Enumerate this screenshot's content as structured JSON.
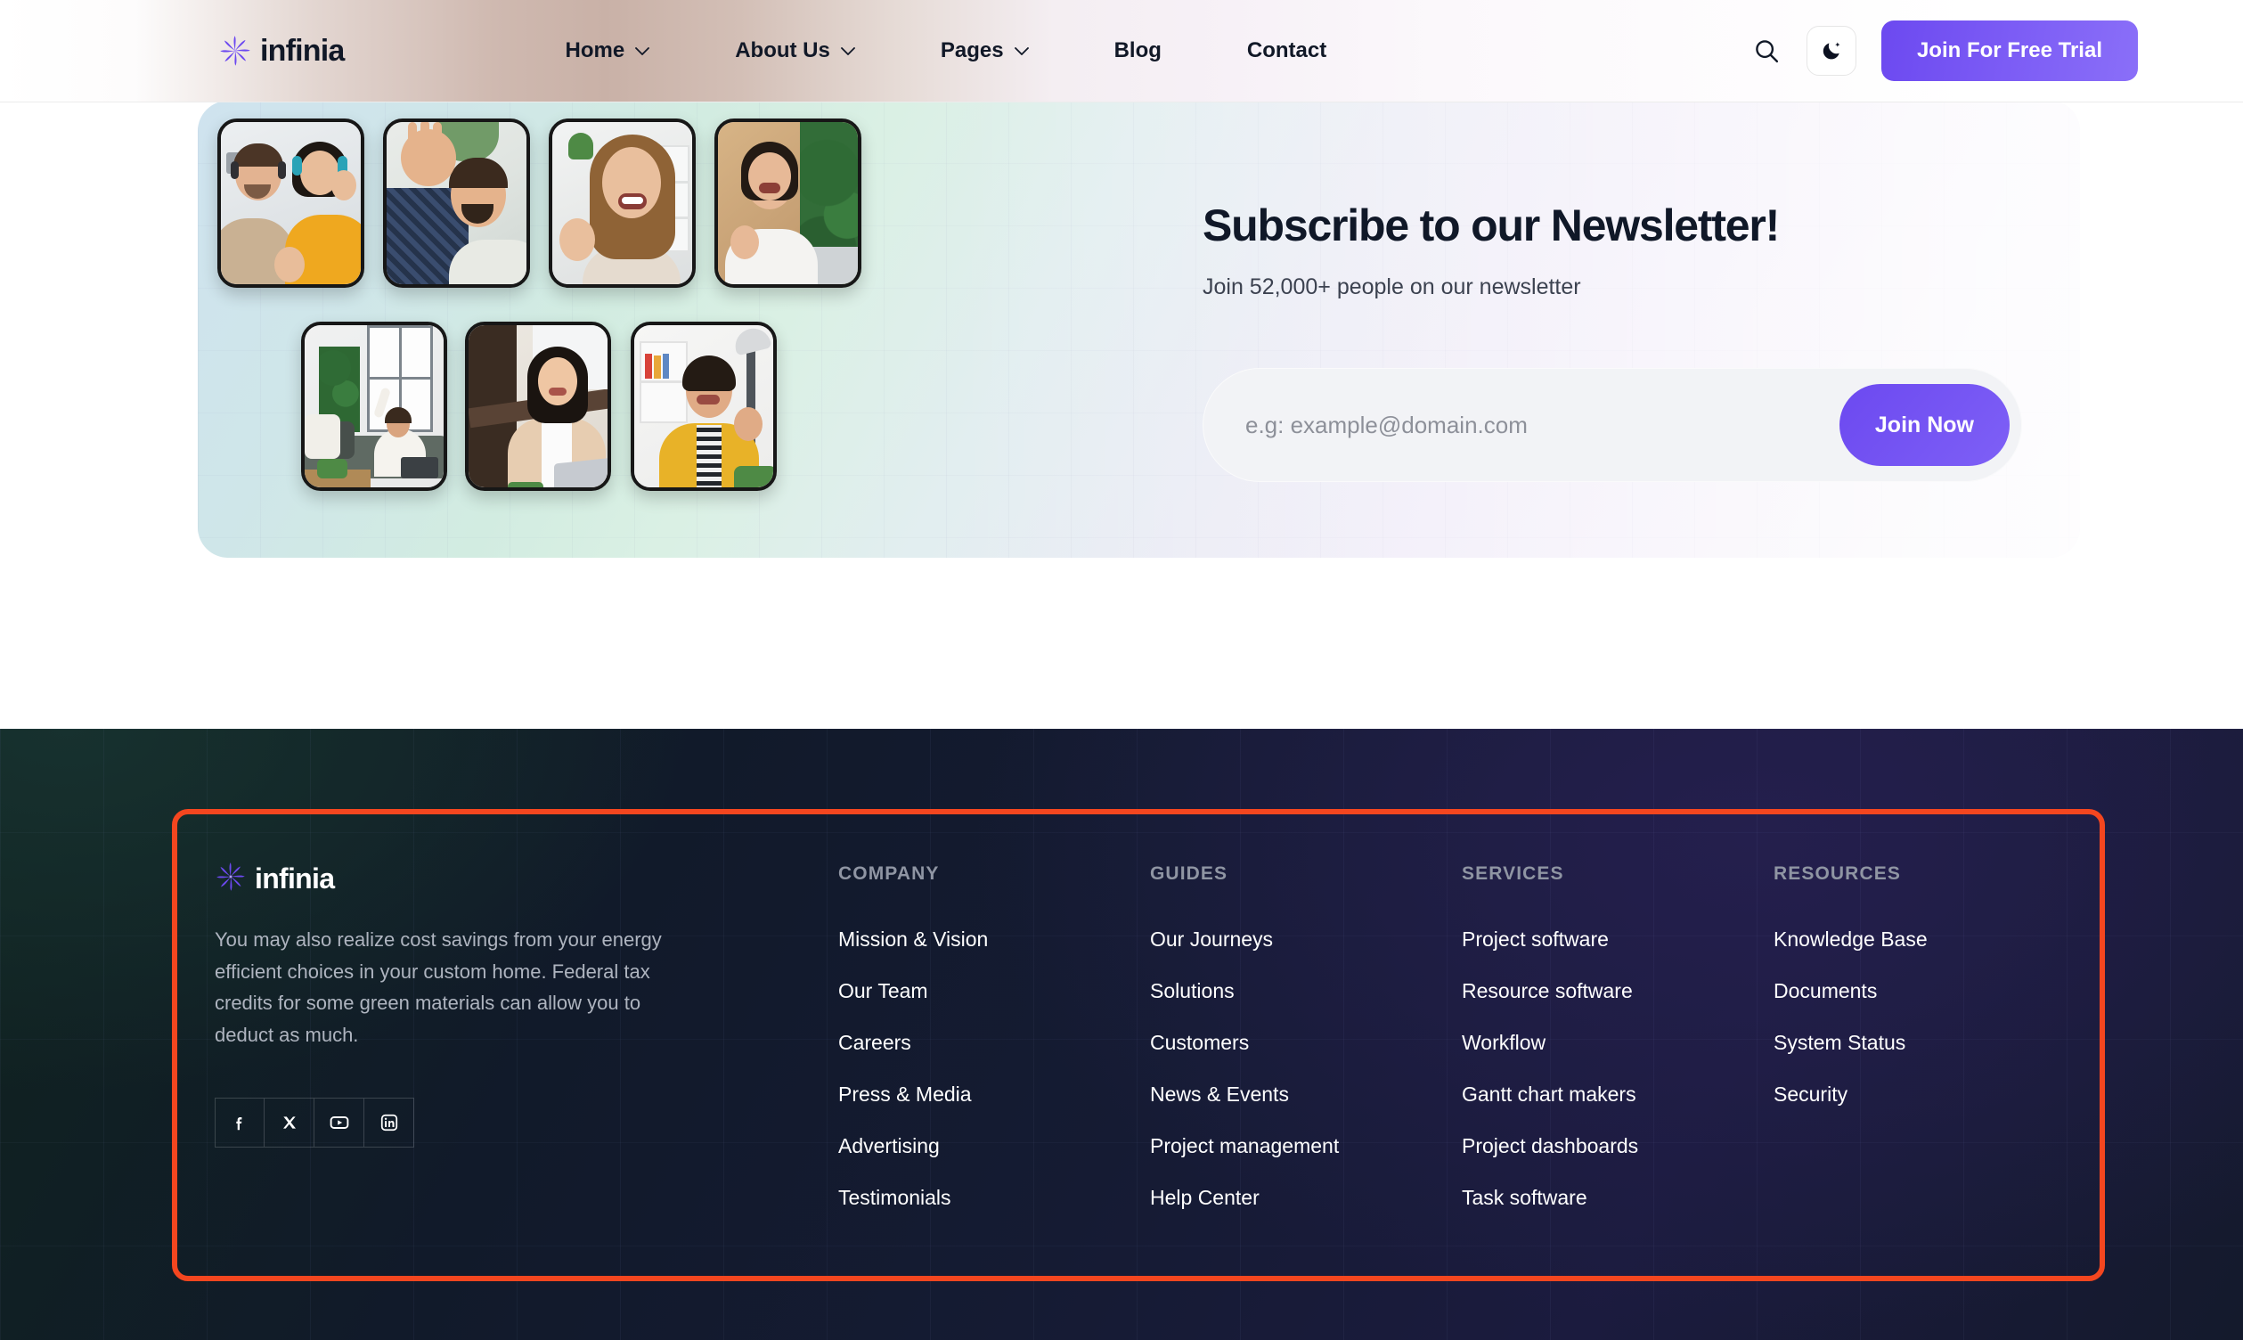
{
  "brand": {
    "name": "infinia",
    "logo_icon": "pinwheel-flower-icon",
    "accent": "#7c5cf5"
  },
  "header": {
    "nav": [
      {
        "label": "Home",
        "has_dropdown": true
      },
      {
        "label": "About Us",
        "has_dropdown": true
      },
      {
        "label": "Pages",
        "has_dropdown": true
      },
      {
        "label": "Blog",
        "has_dropdown": false
      },
      {
        "label": "Contact",
        "has_dropdown": false
      }
    ],
    "search_icon": "search-icon",
    "theme_icon": "moon-dark-mode-icon",
    "cta_label": "Join For Free Trial"
  },
  "newsletter": {
    "title": "Subscribe to our Newsletter!",
    "subtitle": "Join 52,000+ people on our newsletter",
    "email_placeholder": "e.g: example@domain.com",
    "email_value": "",
    "submit_label": "Join Now",
    "photos": [
      {
        "alt": "Smiling couple with headphones waving"
      },
      {
        "alt": "Bearded man lying down waving hand"
      },
      {
        "alt": "Woman with long hair laughing and waving"
      },
      {
        "alt": "Woman in white shirt smiling by plant"
      },
      {
        "alt": "Woman celebrating on couch with laptop"
      },
      {
        "alt": "Woman in beige shirt smiling at laptop"
      },
      {
        "alt": "Man in yellow jacket waving at desk"
      }
    ]
  },
  "footer": {
    "description": "You may also realize cost savings from your energy efficient choices in your custom home. Federal tax credits for some green materials can allow you to deduct as much.",
    "socials": [
      {
        "name": "facebook-icon",
        "label": "Facebook"
      },
      {
        "name": "x-twitter-icon",
        "label": "X"
      },
      {
        "name": "youtube-icon",
        "label": "YouTube"
      },
      {
        "name": "linkedin-icon",
        "label": "LinkedIn"
      }
    ],
    "columns": [
      {
        "heading": "COMPANY",
        "links": [
          "Mission & Vision",
          "Our Team",
          "Careers",
          "Press & Media",
          "Advertising",
          "Testimonials"
        ]
      },
      {
        "heading": "GUIDES",
        "links": [
          "Our Journeys",
          "Solutions",
          "Customers",
          "News & Events",
          "Project management",
          "Help Center"
        ]
      },
      {
        "heading": "SERVICES",
        "links": [
          "Project software",
          "Resource software",
          "Workflow",
          "Gantt chart makers",
          "Project dashboards",
          "Task software"
        ]
      },
      {
        "heading": "RESOURCES",
        "links": [
          "Knowledge Base",
          "Documents",
          "System Status",
          "Security"
        ]
      }
    ],
    "highlight_color": "#f4461f"
  }
}
